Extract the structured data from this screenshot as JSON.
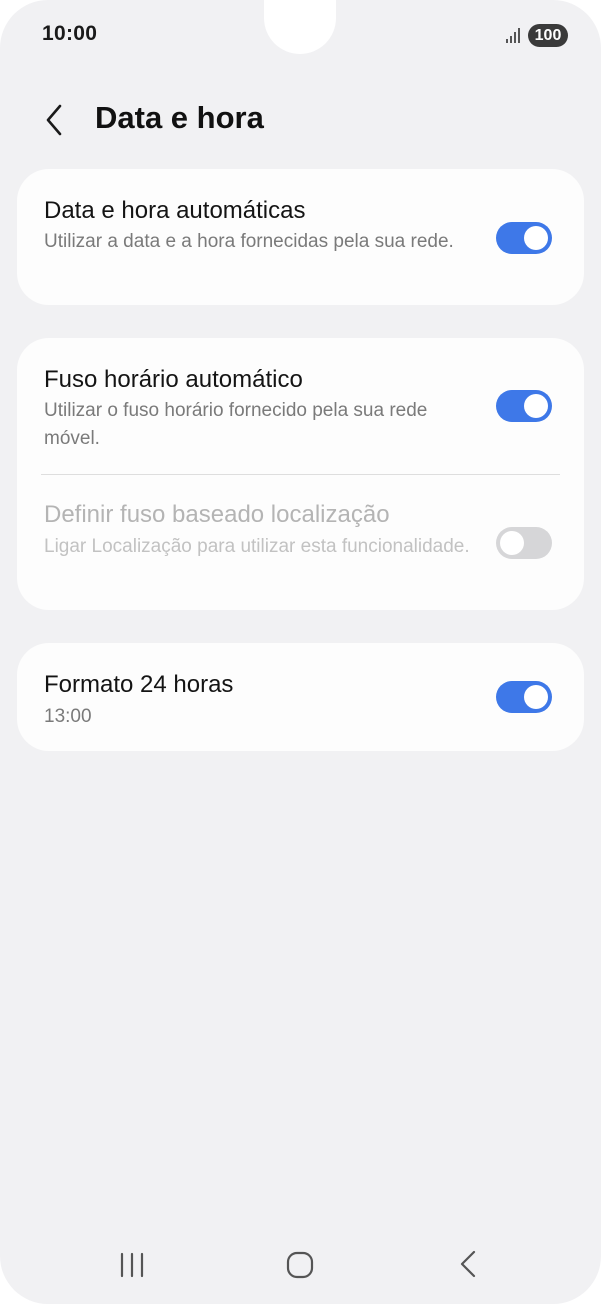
{
  "status_bar": {
    "time": "10:00",
    "battery": "100",
    "signal_icon": "signal-bars-icon"
  },
  "header": {
    "title": "Data e hora",
    "back_icon": "chevron-left-icon"
  },
  "settings": {
    "auto_datetime": {
      "title": "Data e hora automáticas",
      "summary": "Utilizar a data e a hora fornecidas pela sua rede.",
      "enabled": true
    },
    "auto_timezone": {
      "title": "Fuso horário automático",
      "summary": "Utilizar o fuso horário fornecido pela sua rede móvel.",
      "enabled": true
    },
    "location_timezone": {
      "title": "Definir fuso baseado localização",
      "summary": "Ligar Localização para utilizar esta funcionalidade.",
      "enabled": false,
      "disabled_state": true
    },
    "format_24h": {
      "title": "Formato 24 horas",
      "summary": "13:00",
      "enabled": true
    }
  },
  "nav_bar": {
    "recents_icon": "recents-icon",
    "home_icon": "home-icon",
    "back_icon": "back-icon"
  },
  "colors": {
    "background": "#f1f1f3",
    "card": "#fdfdfd",
    "accent": "#3e78e8",
    "toggle_off": "#d6d6d8"
  }
}
